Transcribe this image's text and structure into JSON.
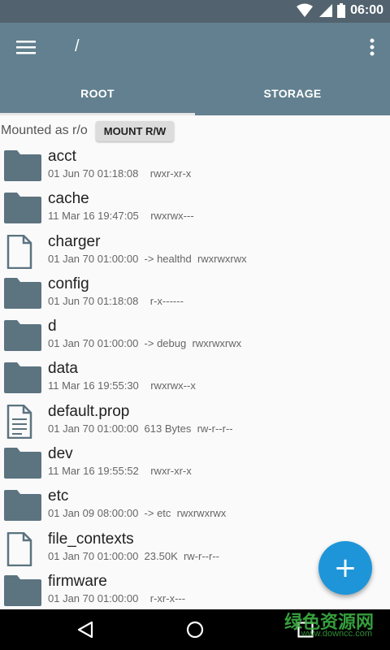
{
  "status_bar": {
    "time": "06:00",
    "icons": [
      "wifi-icon",
      "signal-icon",
      "battery-icon"
    ]
  },
  "toolbar": {
    "path": "/",
    "menu_icon": "hamburger-menu-icon",
    "overflow_icon": "more-vert-icon"
  },
  "tabs": [
    {
      "label": "ROOT",
      "active": true
    },
    {
      "label": "STORAGE",
      "active": false
    }
  ],
  "mount": {
    "status_label": "Mounted as r/o",
    "button_label": "MOUNT R/W"
  },
  "files": [
    {
      "name": "acct",
      "type": "folder",
      "meta": "01 Jun 70 01:18:08    rwxr-xr-x"
    },
    {
      "name": "cache",
      "type": "folder",
      "meta": "11 Mar 16 19:47:05    rwxrwx---"
    },
    {
      "name": "charger",
      "type": "file",
      "meta": "01 Jan 70 01:00:00  -> healthd  rwxrwxrwx"
    },
    {
      "name": "config",
      "type": "folder",
      "meta": "01 Jun 70 01:18:08    r-x------"
    },
    {
      "name": "d",
      "type": "folder",
      "meta": "01 Jan 70 01:00:00  -> debug  rwxrwxrwx"
    },
    {
      "name": "data",
      "type": "folder",
      "meta": "11 Mar 16 19:55:30    rwxrwx--x"
    },
    {
      "name": "default.prop",
      "type": "text-file",
      "meta": "01 Jan 70 01:00:00  613 Bytes  rw-r--r--"
    },
    {
      "name": "dev",
      "type": "folder",
      "meta": "11 Mar 16 19:55:52    rwxr-xr-x"
    },
    {
      "name": "etc",
      "type": "folder",
      "meta": "01 Jan 09 08:00:00  -> etc  rwxrwxrwx"
    },
    {
      "name": "file_contexts",
      "type": "file",
      "meta": "01 Jan 70 01:00:00  23.50K  rw-r--r--"
    },
    {
      "name": "firmware",
      "type": "folder",
      "meta": "01 Jan 70 01:00:00    r-xr-x---"
    }
  ],
  "fab": {
    "label": "+"
  },
  "watermark": {
    "text": "绿色资源网",
    "sub": "www.downcc.com"
  },
  "colors": {
    "status_bar": "#52636f",
    "toolbar": "#62808f",
    "folder_icon": "#5c7380",
    "fab": "#1e95d9"
  }
}
